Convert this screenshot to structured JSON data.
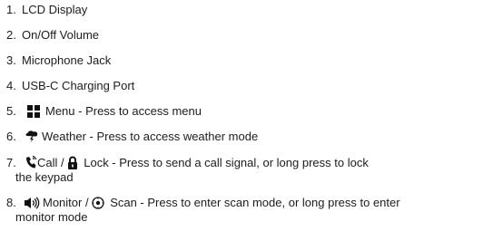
{
  "items": [
    {
      "num": "1.",
      "text": "LCD Display"
    },
    {
      "num": "2.",
      "text": "On/Off Volume"
    },
    {
      "num": "3.",
      "text": "Microphone Jack"
    },
    {
      "num": "4.",
      "text": "USB-C Charging Port"
    },
    {
      "num": "5.",
      "icon": "menu-grid-icon",
      "text": "Menu - Press to access menu"
    },
    {
      "num": "6.",
      "icon": "weather-icon",
      "text": "Weather - Press to access weather mode"
    },
    {
      "num": "7.",
      "icon": "call-signal-icon",
      "text_a": "Call / ",
      "icon_b": "lock-icon",
      "text_b": "Lock - Press to send a call signal, or long press to lock",
      "cont": "the keypad"
    },
    {
      "num": "8.",
      "icon": "speaker-icon",
      "text_a": "Monitor / ",
      "icon_b": "scan-icon",
      "text_b": "Scan - Press to enter scan mode, or long press to enter",
      "cont": "monitor mode"
    }
  ]
}
